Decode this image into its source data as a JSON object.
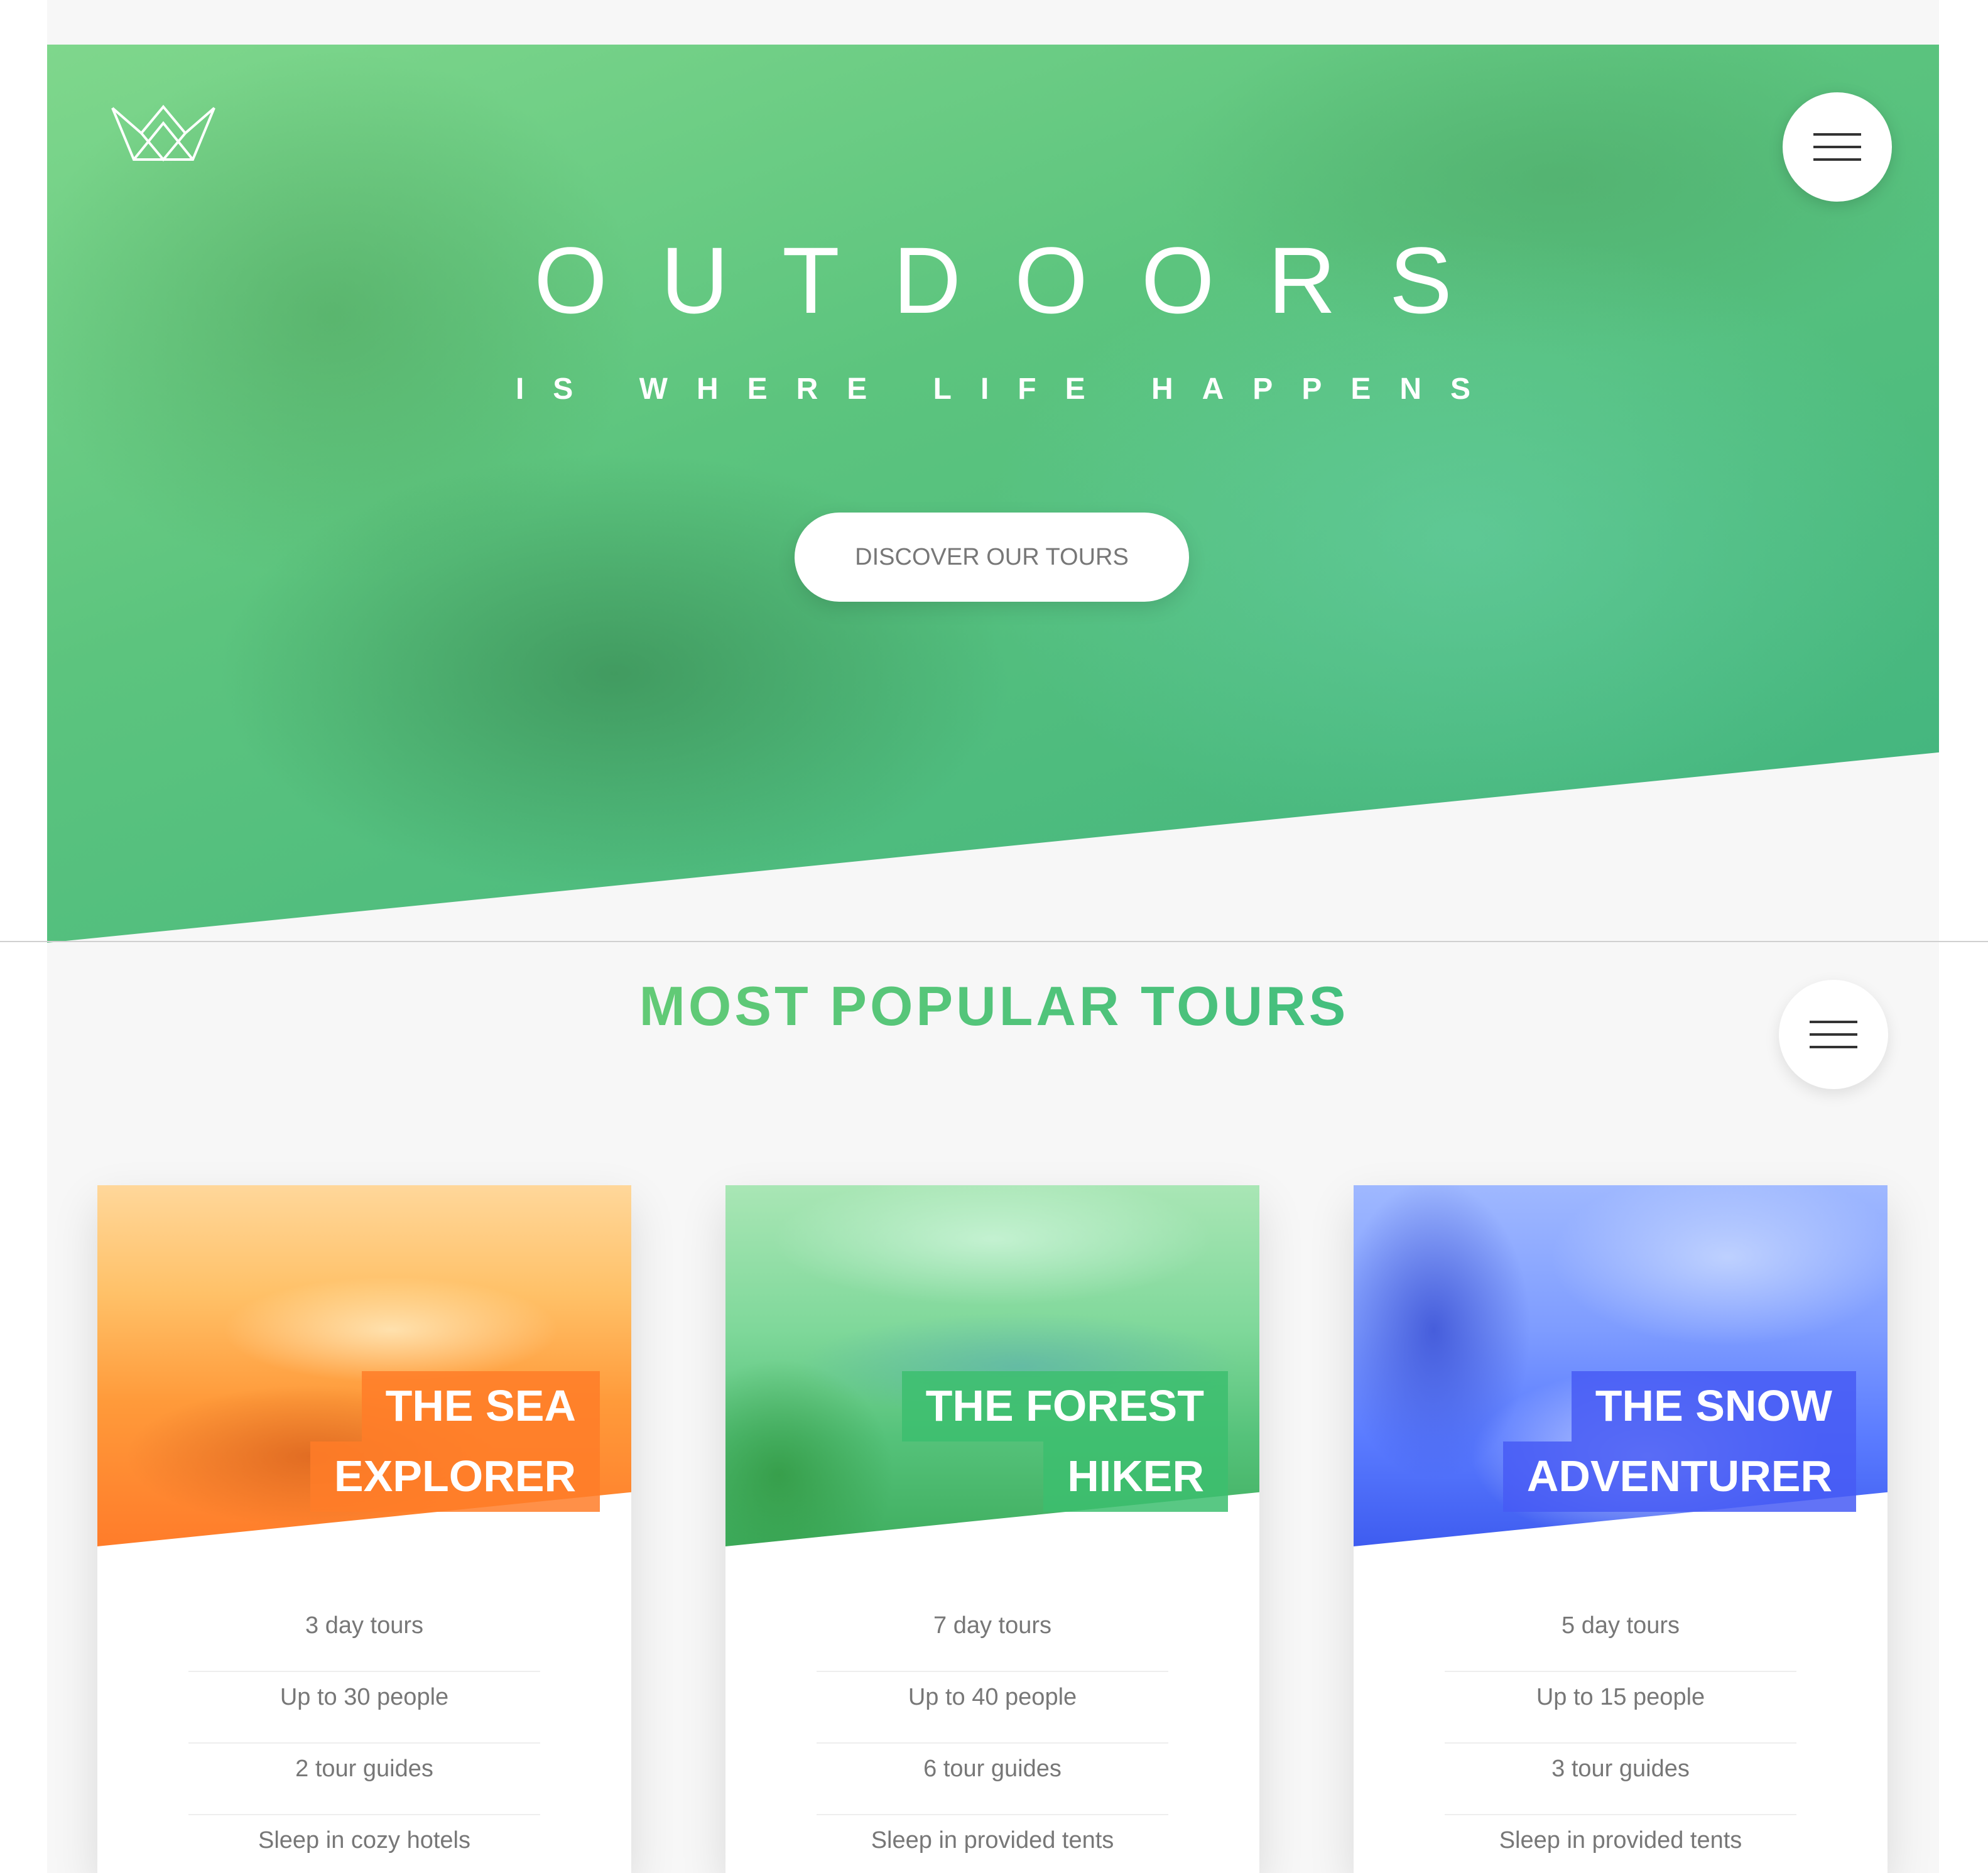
{
  "hero": {
    "title": "OUTDOORS",
    "subtitle": "IS WHERE LIFE HAPPENS",
    "cta_label": "DISCOVER OUR TOURS",
    "logo_icon": "crown-icon",
    "menu_icon": "hamburger-menu-icon"
  },
  "tours": {
    "heading": "MOST POPULAR TOURS",
    "cards": [
      {
        "title_line1": "THE SEA",
        "title_line2": "EXPLORER",
        "details": [
          "3 day tours",
          "Up to 30 people",
          "2 tour guides",
          "Sleep in cozy hotels"
        ],
        "accent": "#ff7730"
      },
      {
        "title_line1": "THE FOREST",
        "title_line2": "HIKER",
        "details": [
          "7 day tours",
          "Up to 40 people",
          "6 tour guides",
          "Sleep in provided tents"
        ],
        "accent": "#28b485"
      },
      {
        "title_line1": "THE SNOW",
        "title_line2": "ADVENTURER",
        "details": [
          "5 day tours",
          "Up to 15 people",
          "3 tour guides",
          "Sleep in provided tents"
        ],
        "accent": "#5643fa"
      }
    ]
  },
  "colors": {
    "primary_light": "#7ed56f",
    "primary_dark": "#28b485",
    "background": "#f7f7f7"
  }
}
